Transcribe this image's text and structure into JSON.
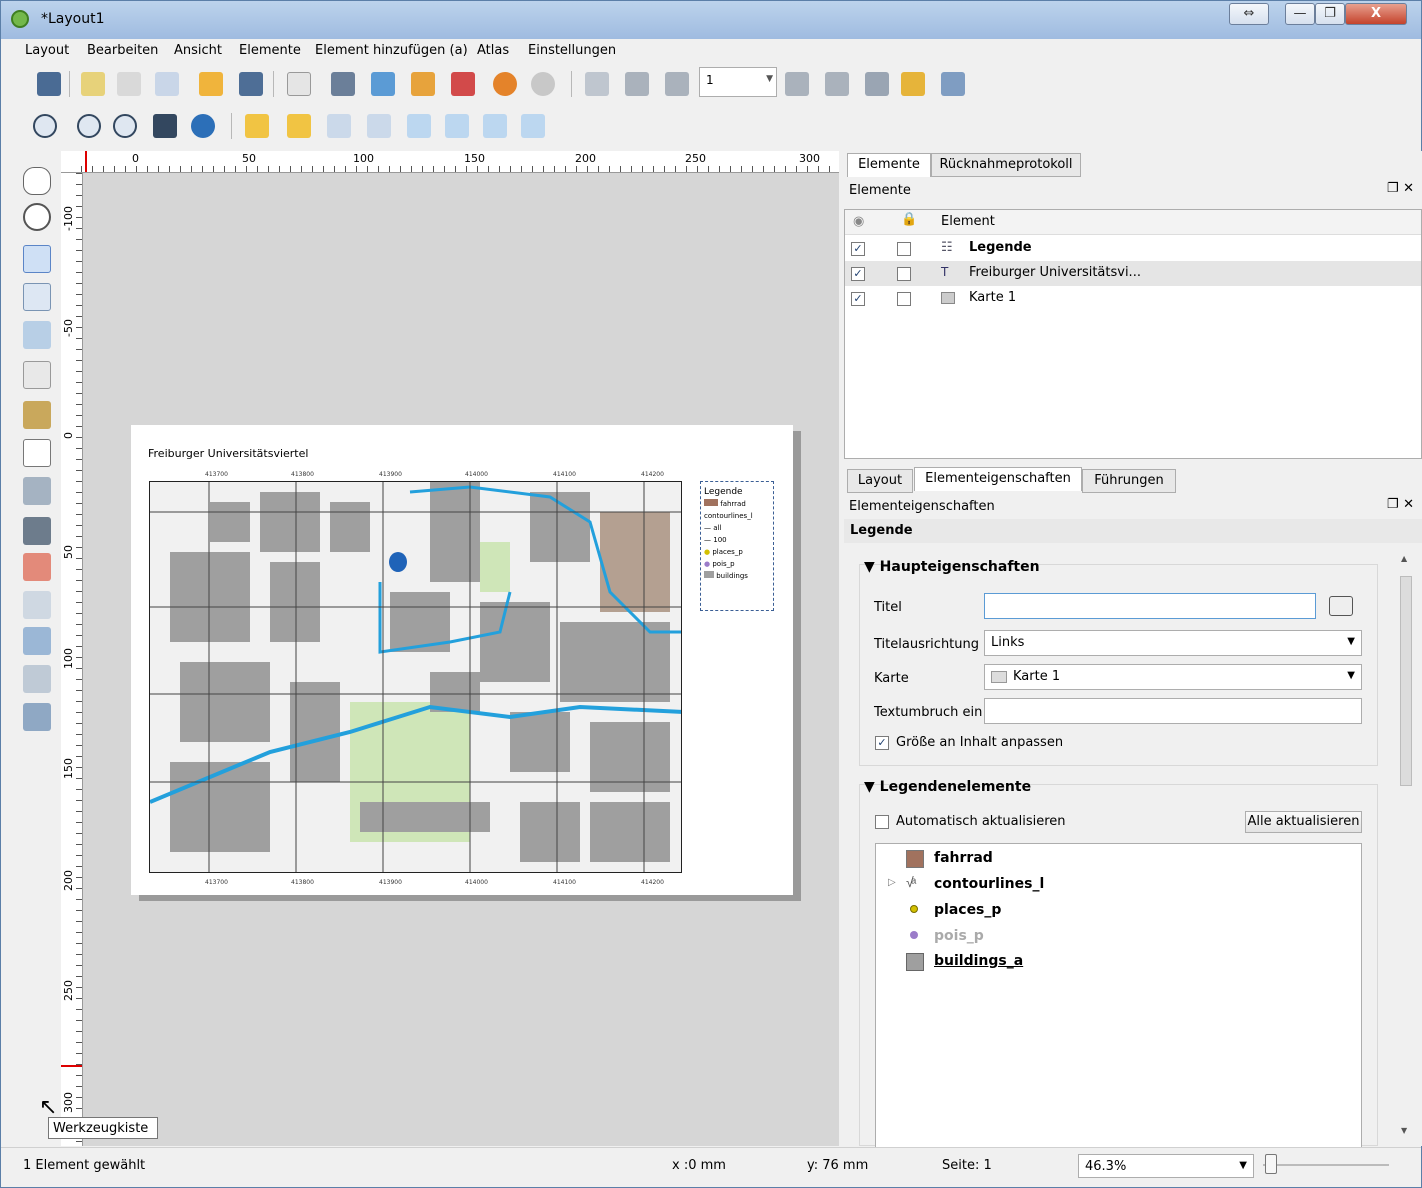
{
  "window": {
    "title": "*Layout1",
    "buttons": [
      "⇔",
      "—",
      "❐",
      "X"
    ]
  },
  "menu": [
    "Layout",
    "Bearbeiten",
    "Ansicht",
    "Elemente",
    "Element hinzufügen (a)",
    "Atlas",
    "Einstellungen"
  ],
  "toolbar": {
    "page_number": "1"
  },
  "rulers": {
    "h": [
      "0",
      "50",
      "100",
      "150",
      "200",
      "250",
      "300"
    ],
    "v": [
      "-100",
      "-50",
      "0",
      "50",
      "100",
      "150",
      "200",
      "250",
      "300"
    ]
  },
  "layout_page": {
    "title": "Freiburger Universitätsviertel",
    "coords_x": [
      "413700",
      "413800",
      "413900",
      "414000",
      "414100",
      "414200"
    ],
    "coords_y": [
      "5316400",
      "5316300",
      "5316200",
      "5316100",
      "5316000"
    ],
    "legend": [
      "Legende",
      "fahrrad",
      "contourlines_l",
      "all",
      "100",
      "places_p",
      "pois_p",
      "buildings"
    ]
  },
  "dock": {
    "tabs_top": [
      "Elemente",
      "Rücknahmeprotokoll"
    ],
    "elements_title": "Elemente",
    "column_header": "Element",
    "elements": [
      {
        "name": "Legende",
        "bold": true
      },
      {
        "name": "Freiburger Universitätsvi...",
        "bold": false
      },
      {
        "name": "Karte 1",
        "bold": false
      }
    ],
    "tabs_bottom": [
      "Layout",
      "Elementeigenschaften",
      "Führungen"
    ],
    "props_title": "Elementeigenschaften",
    "item_type": "Legende",
    "main_props": {
      "title": "Haupteigenschaften",
      "titel_label": "Titel",
      "titel_value": "",
      "align_label": "Titelausrichtung",
      "align_value": "Links",
      "map_label": "Karte",
      "map_value": "Karte 1",
      "wrap_label": "Textumbruch ein",
      "wrap_value": "",
      "resize_label": "Größe an Inhalt anpassen"
    },
    "legend_items": {
      "title": "Legendenelemente",
      "auto_update": "Automatisch aktualisieren",
      "update_all": "Alle aktualisieren",
      "items": [
        "fahrrad",
        "contourlines_l",
        "places_p",
        "pois_p",
        "buildings_a"
      ]
    }
  },
  "status": {
    "selection": "1 Element gewählt",
    "x": "x :0 mm",
    "y": "y: 76 mm",
    "page": "Seite: 1",
    "zoom": "46.3%"
  },
  "tooltip": "Werkzeugkiste",
  "colors": {
    "fahrrad": "#a1725e",
    "buildings": "#9f9f9f",
    "places": "#d3c000",
    "pois": "#9b7cc9",
    "water": "#23a0dc"
  }
}
